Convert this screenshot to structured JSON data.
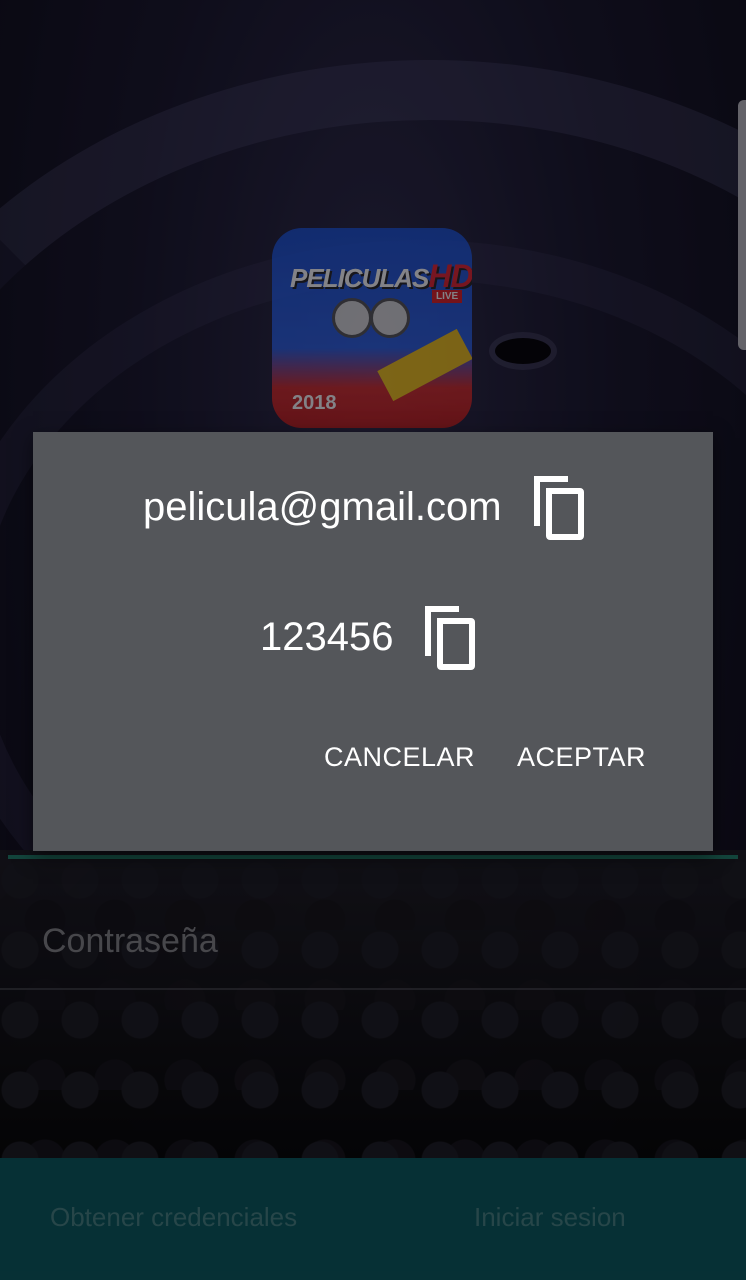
{
  "logo": {
    "title_main": "PELICULAS",
    "title_hd": "HD",
    "badge": "LIVE",
    "year": "2018"
  },
  "dialog": {
    "email": "pelicula@gmail.com",
    "password": "123456",
    "cancel_label": "CANCELAR",
    "accept_label": "ACEPTAR",
    "copy_icon": "content-copy-icon"
  },
  "form": {
    "password_placeholder": "Contraseña"
  },
  "bottom_bar": {
    "get_credentials_label": "Obtener credenciales",
    "login_label": "Iniciar sesion"
  },
  "colors": {
    "dialog_bg": "#54565a",
    "bottom_bar": "#0a4a52",
    "accent_line": "#1e6a5c"
  }
}
